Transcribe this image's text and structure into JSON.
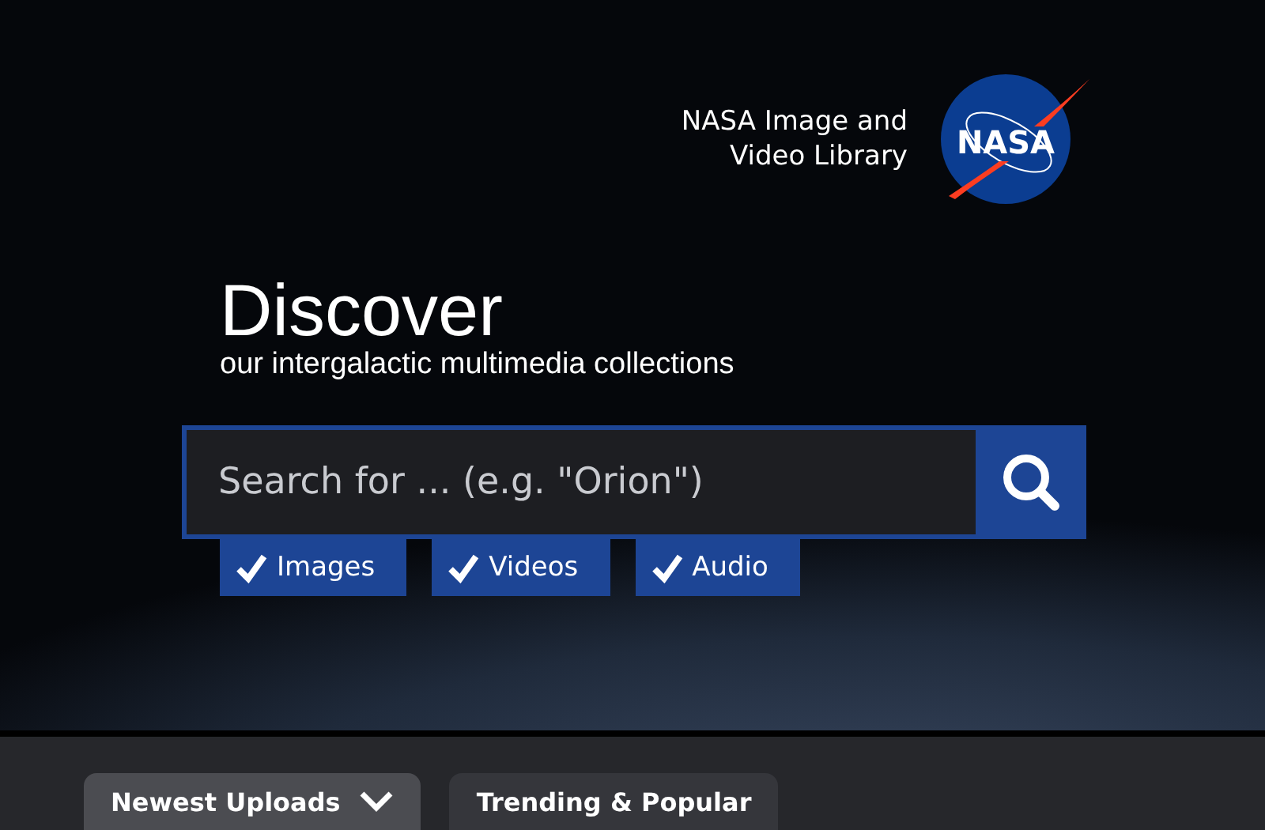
{
  "header": {
    "site_title": "NASA Image and Video Library",
    "logo_text": "NASA"
  },
  "hero": {
    "title": "Discover",
    "subtitle": "our intergalactic multimedia collections"
  },
  "search": {
    "placeholder": "Search for ... (e.g. \"Orion\")"
  },
  "filters": [
    {
      "label": "Images",
      "checked": true
    },
    {
      "label": "Videos",
      "checked": true
    },
    {
      "label": "Audio",
      "checked": true
    }
  ],
  "tabs": [
    {
      "label": "Newest Uploads",
      "selected": true,
      "dropdown": true
    },
    {
      "label": "Trending & Popular",
      "selected": false,
      "dropdown": false
    }
  ]
}
